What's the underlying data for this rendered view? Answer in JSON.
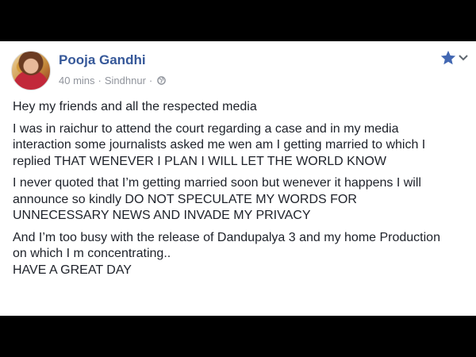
{
  "post": {
    "author": "Pooja Gandhi",
    "time": "40 mins",
    "separator": "·",
    "location": "Sindhnur",
    "privacy_icon": "globe-icon",
    "action_icon": "star-icon",
    "menu_icon": "chevron-down-icon",
    "accent_color": "#4267b2",
    "paragraphs": [
      [
        "Hey my friends and all the respected media"
      ],
      [
        "I was in raichur to attend the court regarding a case and in my media",
        "interaction some journalists asked me wen am I getting married to which I",
        "replied THAT WENEVER I PLAN I WILL LET THE WORLD KNOW"
      ],
      [
        "I never quoted that I’m getting married soon but wenever it happens I will",
        "announce so kindly DO NOT SPECULATE MY WORDS FOR",
        "UNNECESSARY NEWS AND INVADE MY PRIVACY"
      ],
      [
        "And I’m too busy with the release of Dandupalya 3 and my home Production",
        "on which I m concentrating..",
        "HAVE A GREAT DAY"
      ]
    ]
  }
}
